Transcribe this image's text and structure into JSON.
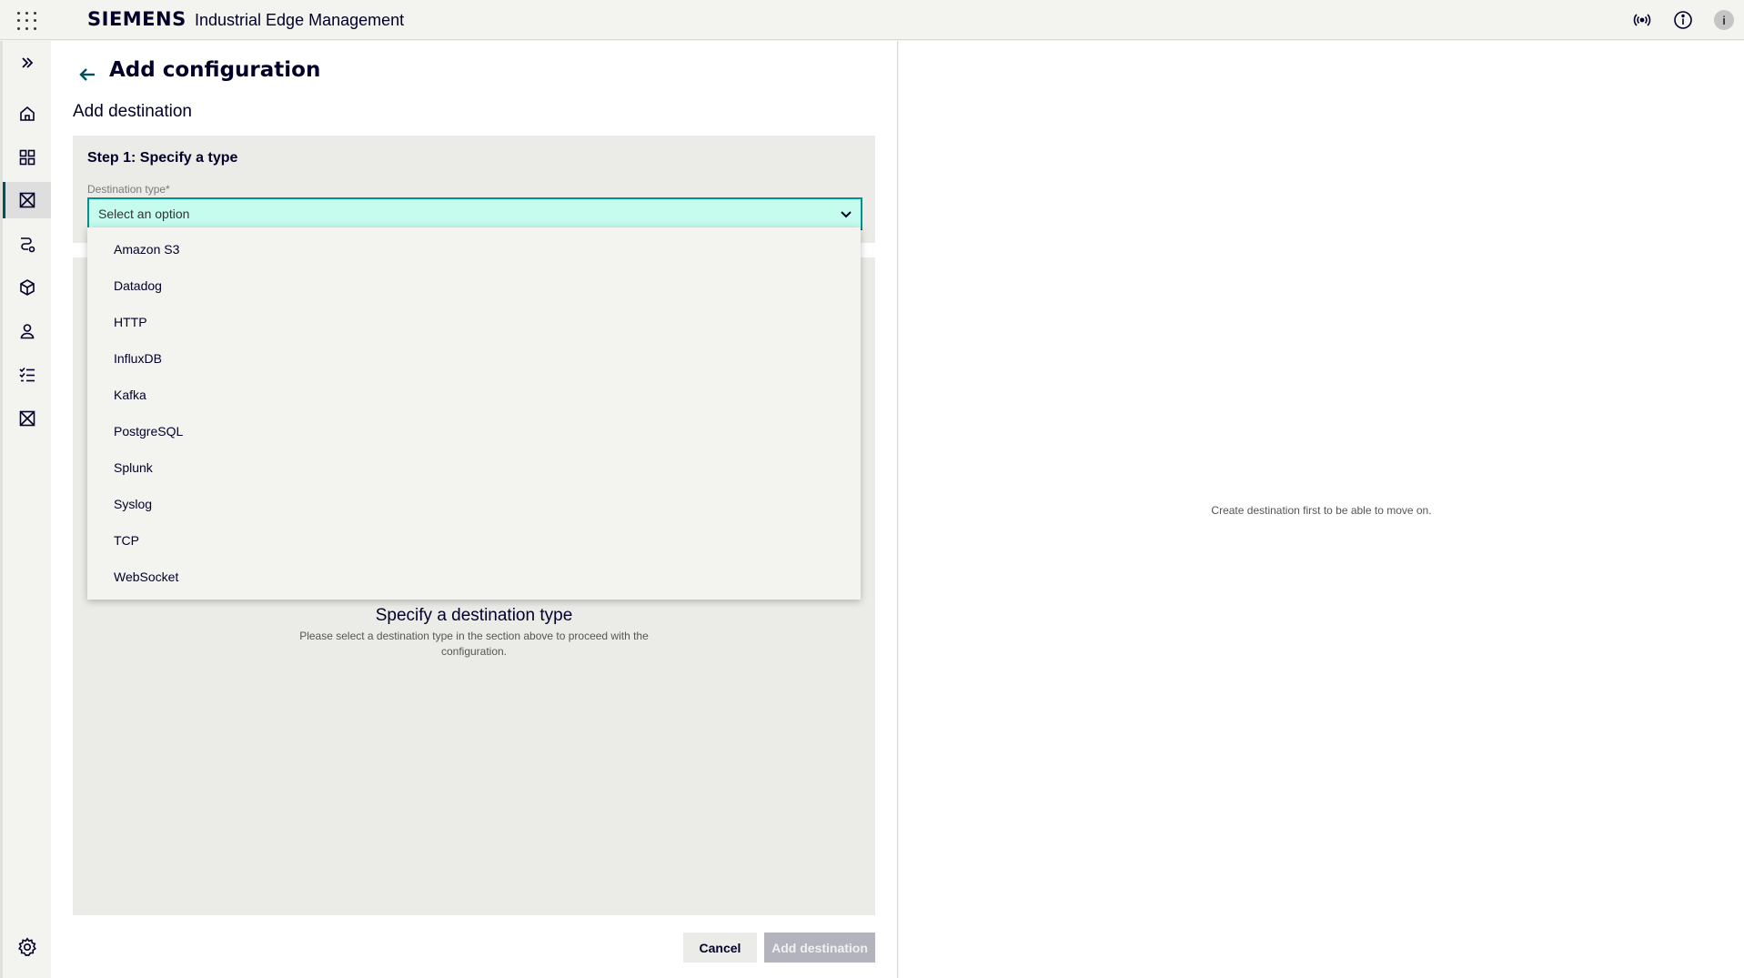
{
  "header": {
    "brand": "SIEMENS",
    "app_title": "Industrial Edge Management",
    "user_initial": "i",
    "icons": [
      "app-switcher-icon",
      "broadcast-icon",
      "info-icon",
      "user-avatar"
    ]
  },
  "sidebar": {
    "items": [
      {
        "icon": "expand-icon"
      },
      {
        "icon": "home-icon"
      },
      {
        "icon": "dashboard-icon"
      },
      {
        "icon": "data-icon",
        "active": true
      },
      {
        "icon": "flow-icon"
      },
      {
        "icon": "package-icon"
      },
      {
        "icon": "user-icon"
      },
      {
        "icon": "tasks-icon"
      },
      {
        "icon": "data-icon"
      },
      {
        "icon": "settings-icon"
      }
    ]
  },
  "page": {
    "title": "Add configuration",
    "subtitle": "Add destination"
  },
  "step": {
    "title": "Step 1: Specify a type",
    "field_label": "Destination type*",
    "select_placeholder": "Select an option"
  },
  "dropdown": {
    "options": [
      "Amazon S3",
      "Datadog",
      "HTTP",
      "InfluxDB",
      "Kafka",
      "PostgreSQL",
      "Splunk",
      "Syslog",
      "TCP",
      "WebSocket"
    ]
  },
  "empty_state": {
    "title": "Specify a destination type",
    "description": "Please select a destination type in the section above to proceed with the configuration."
  },
  "buttons": {
    "cancel": "Cancel",
    "add": "Add destination"
  },
  "right_panel": {
    "message": "Create destination first to be able to move on."
  },
  "colors": {
    "accent": "#005159",
    "select_bg": "#c5fcee",
    "select_border": "#00928c"
  }
}
